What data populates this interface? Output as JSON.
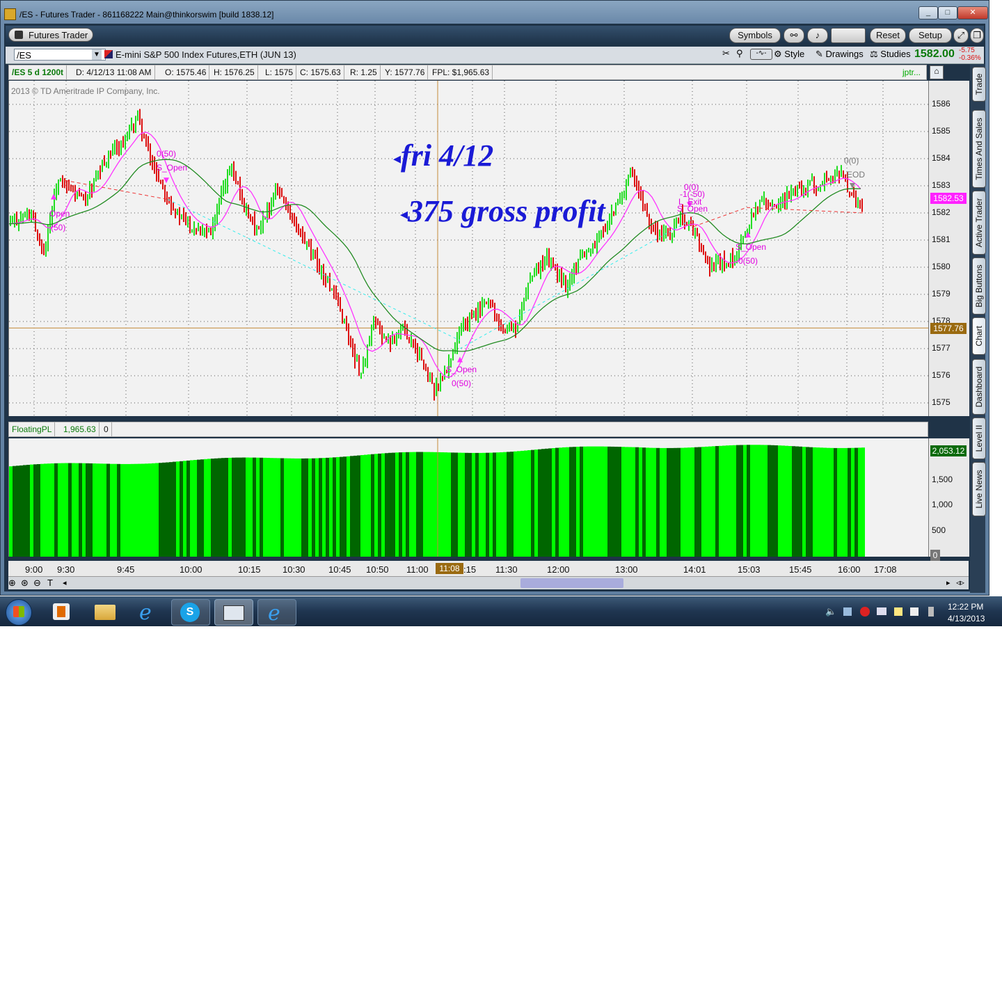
{
  "window": {
    "title": "/ES - Futures Trader - 861168222 Main@thinkorswim [build 1838.12]",
    "app_tab": "Futures Trader",
    "controls": [
      "_",
      "□",
      "✕"
    ]
  },
  "toolbar": {
    "symbols_label": "Symbols",
    "reset_label": "Reset",
    "setup_label": "Setup"
  },
  "chart_toolbar": {
    "symbol_value": "/ES",
    "description": "E-mini S&P 500 Index Futures,ETH (JUN 13)",
    "style_label": "Style",
    "drawings_label": "Drawings",
    "studies_label": "Studies",
    "last_price": "1582.00",
    "change": "-5.75",
    "change_pct": "-0.36%"
  },
  "infobar": {
    "chart_id": "/ES 5 d 1200t",
    "date": "D: 4/12/13 11:08 AM",
    "open": "O: 1575.46",
    "high": "H: 1576.25",
    "low": "L: 1575",
    "close": "C: 1575.63",
    "range": "R: 1.25",
    "y": "Y: 1577.76",
    "fpl": "FPL: $1,965.63",
    "trailing": "jptr..."
  },
  "chart": {
    "copyright": "2013 © TD Ameritrade IP Company, Inc.",
    "y_ticks": [
      "1586",
      "1585",
      "1584",
      "1583",
      "1582",
      "1581",
      "1580",
      "1579",
      "1578",
      "1577",
      "1576",
      "1575"
    ],
    "price_marker": "1582.53",
    "cursor_marker": "1577.76",
    "annotation_1": "fri 4/12",
    "annotation_2": "375 gross profit",
    "trade_labels": [
      "Open",
      "(50)",
      "0(50)",
      "S_Open",
      "S_Open",
      "0(50)",
      "0(0)",
      "-1(-50)",
      "L_Exit",
      "S_Open",
      "S_Open",
      "0(50)",
      "0(0)",
      "EOD"
    ]
  },
  "lower": {
    "study_name": "FloatingPL",
    "study_value": "1,965.63",
    "study_extra": "0",
    "y_ticks": [
      "1,500",
      "1,000",
      "500",
      "0"
    ],
    "marker": "2,053.12"
  },
  "xaxis": {
    "ticks": [
      "9:00",
      "9:30",
      "9:45",
      "10:00",
      "10:15",
      "10:30",
      "10:45",
      "10:50",
      "11:00",
      ":15",
      "11:30",
      "12:00",
      "13:00",
      "14:01",
      "15:03",
      "15:45",
      "16:00",
      "17:08"
    ],
    "cursor": "11:08"
  },
  "side_tabs": [
    "Trade",
    "Times And Sales",
    "Active Trader",
    "Big Buttons",
    "Chart",
    "Dashboard",
    "Level II",
    "Live News"
  ],
  "taskbar": {
    "time": "12:22 PM",
    "date": "4/13/2013"
  },
  "colors": {
    "up_bar": "#22dd22",
    "down_bar": "#dd1111",
    "ma_fast": "#ff33ff",
    "ma_slow": "#228b22",
    "pl_light": "#00ff00",
    "pl_dark": "#006600",
    "annotation": "#1a1ad6"
  }
}
